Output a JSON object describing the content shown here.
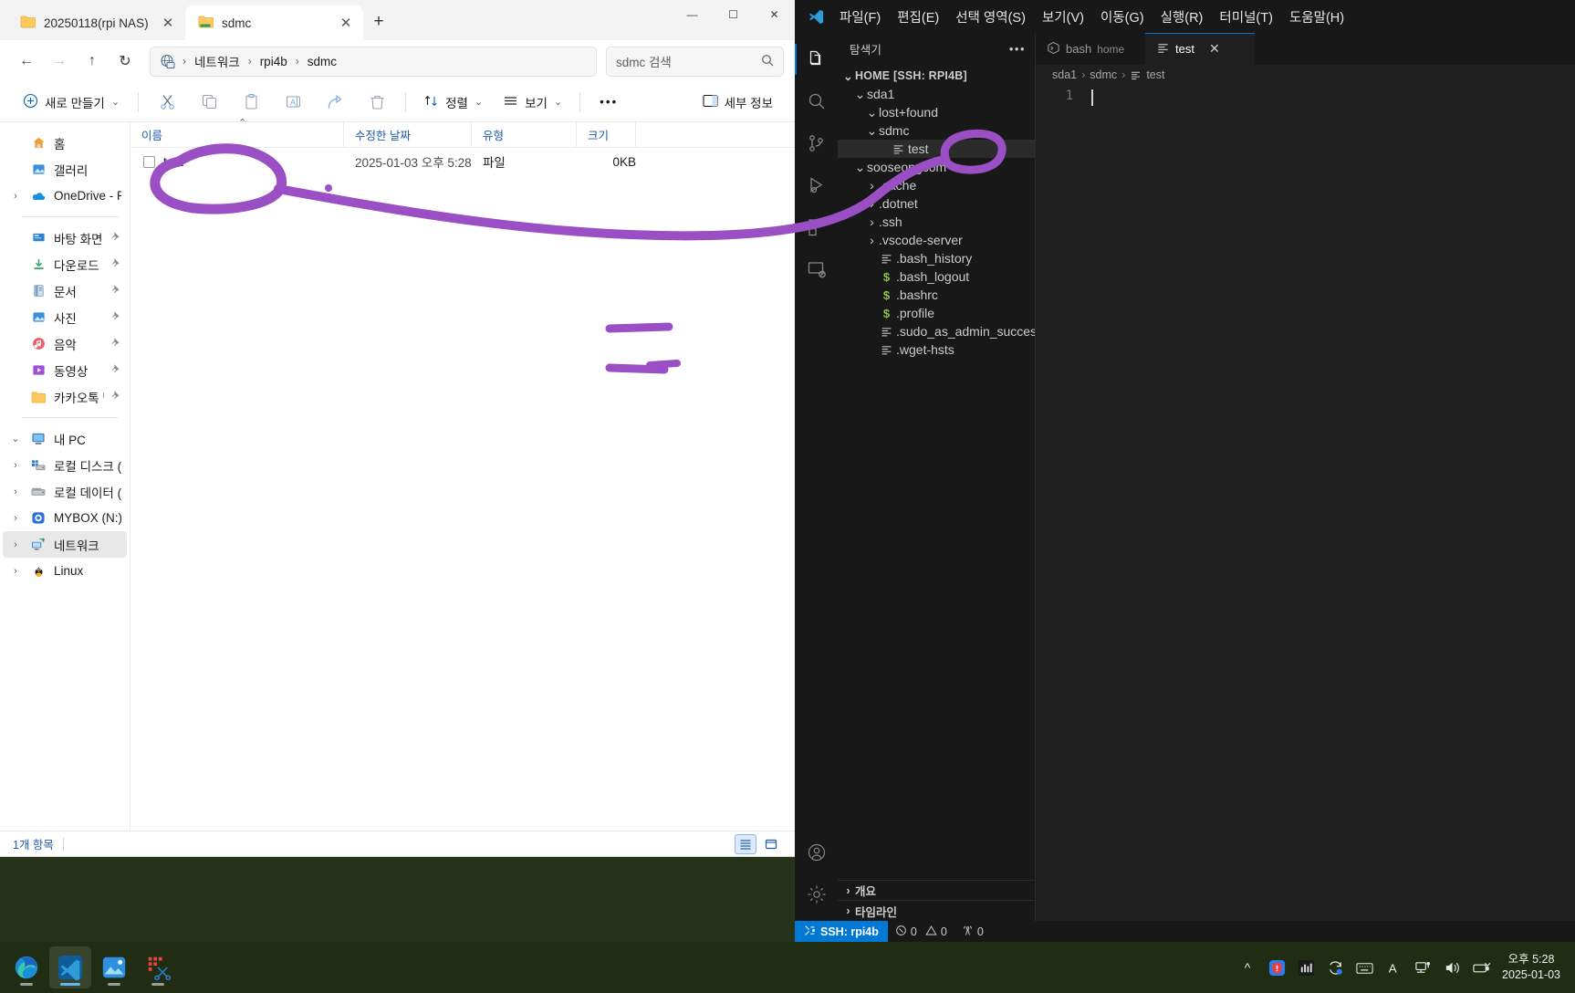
{
  "explorer": {
    "tabs": [
      {
        "label": "20250118(rpi NAS)",
        "active": false,
        "icon": "folder-icon"
      },
      {
        "label": "sdmc",
        "active": true,
        "icon": "folder-network-icon"
      }
    ],
    "new_tab_label": "+",
    "window_controls": {
      "minimize": "—",
      "maximize": "☐",
      "close": "✕"
    },
    "nav": {
      "back": "←",
      "forward": "→",
      "up": "↑",
      "refresh": "↻"
    },
    "address": {
      "icon": "network-globe-icon",
      "crumbs": [
        "네트워크",
        "rpi4b",
        "sdmc"
      ]
    },
    "search": {
      "placeholder": "sdmc 검색",
      "icon": "search-icon"
    },
    "toolbar": {
      "new_label": "새로 만들기",
      "new_caret": "⌄",
      "cut": "cut-icon",
      "copy": "copy-icon",
      "paste": "paste-icon",
      "rename": "rename-icon",
      "share": "share-icon",
      "delete": "delete-icon",
      "sort_label": "정렬",
      "view_label": "보기",
      "more_label": "•••",
      "details_label": "세부 정보"
    },
    "sidebar": [
      {
        "label": "홈",
        "icon": "home-icon",
        "twisty": "",
        "pin": false,
        "selected": false
      },
      {
        "label": "갤러리",
        "icon": "gallery-icon",
        "twisty": "",
        "pin": false,
        "selected": false
      },
      {
        "label": "OneDrive - Person",
        "icon": "onedrive-icon",
        "twisty": "›",
        "pin": false,
        "selected": false
      },
      {
        "divider": true
      },
      {
        "label": "바탕 화면",
        "icon": "desktop-icon",
        "twisty": "",
        "pin": true,
        "selected": false
      },
      {
        "label": "다운로드",
        "icon": "downloads-icon",
        "twisty": "",
        "pin": true,
        "selected": false
      },
      {
        "label": "문서",
        "icon": "documents-icon",
        "twisty": "",
        "pin": true,
        "selected": false
      },
      {
        "label": "사진",
        "icon": "pictures-icon",
        "twisty": "",
        "pin": true,
        "selected": false
      },
      {
        "label": "음악",
        "icon": "music-icon",
        "twisty": "",
        "pin": true,
        "selected": false
      },
      {
        "label": "동영상",
        "icon": "videos-icon",
        "twisty": "",
        "pin": true,
        "selected": false
      },
      {
        "label": "카카오톡 받은 I",
        "icon": "folder-icon",
        "twisty": "",
        "pin": true,
        "selected": false
      },
      {
        "divider": true
      },
      {
        "label": "내 PC",
        "icon": "thispc-icon",
        "twisty": "⌄",
        "pin": false,
        "selected": false
      },
      {
        "label": "로컬 디스크 (C:)",
        "icon": "drive-windows-icon",
        "twisty": "›",
        "pin": false,
        "selected": false
      },
      {
        "label": "로컬 데이터 (D:)",
        "icon": "drive-icon",
        "twisty": "›",
        "pin": false,
        "selected": false
      },
      {
        "label": "MYBOX (N:)",
        "icon": "mybox-icon",
        "twisty": "›",
        "pin": false,
        "selected": false
      },
      {
        "label": "네트워크",
        "icon": "network-icon",
        "twisty": "›",
        "pin": false,
        "selected": true
      },
      {
        "label": "Linux",
        "icon": "linux-icon",
        "twisty": "›",
        "pin": false,
        "selected": false
      }
    ],
    "columns": [
      {
        "label": "이름",
        "key": "name",
        "sorted": true
      },
      {
        "label": "수정한 날짜",
        "key": "date"
      },
      {
        "label": "유형",
        "key": "type"
      },
      {
        "label": "크기",
        "key": "size"
      }
    ],
    "rows": [
      {
        "name": "test",
        "date": "2025-01-03 오후 5:28",
        "type": "파일",
        "size": "0KB",
        "checked": false
      }
    ],
    "status": {
      "count_label": "1개 항목"
    },
    "view_toggle": {
      "list": "list-view-icon",
      "details": "details-view-icon",
      "active": "list"
    }
  },
  "vscode": {
    "menus": [
      "파일(F)",
      "편집(E)",
      "선택 영역(S)",
      "보기(V)",
      "이동(G)",
      "실행(R)",
      "터미널(T)",
      "도움말(H)"
    ],
    "activity_icons": [
      {
        "name": "explorer-icon",
        "active": true
      },
      {
        "name": "search-icon",
        "active": false
      },
      {
        "name": "source-control-icon",
        "active": false
      },
      {
        "name": "run-debug-icon",
        "active": false
      },
      {
        "name": "extensions-icon",
        "active": false
      },
      {
        "name": "remote-explorer-icon",
        "active": false
      }
    ],
    "activity_bottom": [
      {
        "name": "accounts-icon"
      },
      {
        "name": "settings-gear-icon"
      }
    ],
    "sidebar_title": "탐색기",
    "sidebar_more": "•••",
    "tree": [
      {
        "label": "HOME [SSH: RPI4B]",
        "depth": 0,
        "twisty": "⌄",
        "icon": "",
        "root": true,
        "selected": false
      },
      {
        "label": "sda1",
        "depth": 1,
        "twisty": "⌄",
        "icon": "",
        "selected": false
      },
      {
        "label": "lost+found",
        "depth": 2,
        "twisty": "⌄",
        "icon": "",
        "selected": false
      },
      {
        "label": "sdmc",
        "depth": 2,
        "twisty": "⌄",
        "icon": "",
        "selected": false
      },
      {
        "label": "test",
        "depth": 3,
        "twisty": "",
        "icon": "lines-icon",
        "selected": true
      },
      {
        "label": "sooseongcom",
        "depth": 1,
        "twisty": "⌄",
        "icon": "",
        "selected": false
      },
      {
        "label": ".cache",
        "depth": 2,
        "twisty": "›",
        "icon": "",
        "selected": false
      },
      {
        "label": ".dotnet",
        "depth": 2,
        "twisty": "›",
        "icon": "",
        "selected": false
      },
      {
        "label": ".ssh",
        "depth": 2,
        "twisty": "›",
        "icon": "",
        "selected": false
      },
      {
        "label": ".vscode-server",
        "depth": 2,
        "twisty": "›",
        "icon": "",
        "selected": false
      },
      {
        "label": ".bash_history",
        "depth": 2,
        "twisty": "",
        "icon": "lines-icon",
        "selected": false
      },
      {
        "label": ".bash_logout",
        "depth": 2,
        "twisty": "",
        "icon": "dollar-icon",
        "selected": false
      },
      {
        "label": ".bashrc",
        "depth": 2,
        "twisty": "",
        "icon": "dollar-icon",
        "selected": false
      },
      {
        "label": ".profile",
        "depth": 2,
        "twisty": "",
        "icon": "dollar-icon",
        "selected": false
      },
      {
        "label": ".sudo_as_admin_successful",
        "depth": 2,
        "twisty": "",
        "icon": "lines-icon",
        "selected": false
      },
      {
        "label": ".wget-hsts",
        "depth": 2,
        "twisty": "",
        "icon": "lines-icon",
        "selected": false
      }
    ],
    "sidebar_sections": [
      {
        "label": "개요",
        "twisty": "›"
      },
      {
        "label": "타임라인",
        "twisty": "›"
      }
    ],
    "tabs": [
      {
        "label": "bash",
        "sub": "home",
        "icon": "terminal-icon",
        "active": false,
        "closable": false
      },
      {
        "label": "test",
        "sub": "",
        "icon": "lines-icon",
        "active": true,
        "closable": true,
        "close": "✕"
      }
    ],
    "breadcrumb": [
      "sda1",
      "sdmc",
      "test"
    ],
    "breadcrumb_sep": "›",
    "editor": {
      "line_numbers": [
        "1"
      ],
      "lines": [
        ""
      ]
    },
    "statusbar": {
      "remote_icon": "remote-ssh-icon",
      "remote_label": "SSH: rpi4b",
      "errors_icon": "error-circle-icon",
      "errors": "0",
      "warnings_icon": "warning-triangle-icon",
      "warnings": "0",
      "ports_icon": "radio-tower-icon",
      "ports": "0"
    }
  },
  "taskbar": {
    "apps": [
      {
        "name": "edge-icon",
        "running": true,
        "active": false
      },
      {
        "name": "vscode-icon",
        "running": true,
        "active": true
      },
      {
        "name": "photos-icon",
        "running": true,
        "active": false
      },
      {
        "name": "snipping-tool-icon",
        "running": true,
        "active": false
      }
    ],
    "tray": [
      {
        "name": "show-hidden-icons-chevron"
      },
      {
        "name": "security-notification-icon"
      },
      {
        "name": "equalizer-icon"
      },
      {
        "name": "sync-icon"
      },
      {
        "name": "keyboard-ime-icon"
      },
      {
        "name": "ime-korean-icon"
      },
      {
        "name": "network-icon"
      },
      {
        "name": "volume-icon"
      },
      {
        "name": "battery-icon"
      }
    ],
    "clock": {
      "time": "오후 5:28",
      "date": "2025-01-03"
    }
  },
  "annotation": {
    "color": "#9a4fc4"
  }
}
